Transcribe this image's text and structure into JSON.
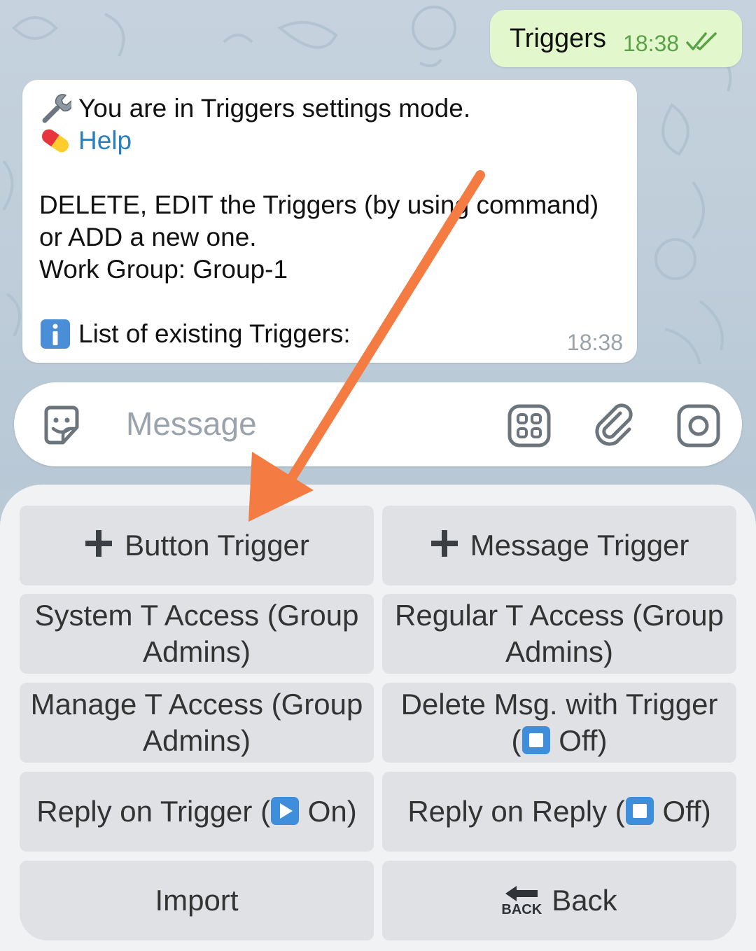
{
  "chat": {
    "outgoing": {
      "text": "Triggers",
      "time": "18:38"
    },
    "incoming": {
      "line1": "You are in Triggers settings mode.",
      "help": "Help",
      "line3": "DELETE, EDIT the Triggers (by using command)",
      "line4": "or ADD a new one.",
      "line5": "Work Group: Group-1",
      "line7": "List of existing Triggers:",
      "time": "18:38"
    }
  },
  "input": {
    "placeholder": "Message"
  },
  "keyboard": {
    "button_trigger": "Button Trigger",
    "message_trigger": "Message Trigger",
    "system_access": "System T Access (Group Admins)",
    "regular_access": "Regular T Access (Group Admins)",
    "manage_access": "Manage T Access (Group Admins)",
    "delete_msg_a": "Delete Msg. with Trigger",
    "delete_msg_b_pre": "(",
    "delete_msg_b_post": " Off)",
    "reply_trigger_pre": "Reply on Trigger (",
    "reply_trigger_post": " On)",
    "reply_reply_pre": "Reply on Reply (",
    "reply_reply_post": " Off)",
    "import": "Import",
    "back": "Back",
    "back_icon_text": "BACK"
  },
  "icons": {
    "wrench": "wrench-icon",
    "pill": "pill-icon",
    "info": "info-icon",
    "sticker": "sticker-icon",
    "apps": "apps-icon",
    "attach": "paperclip-icon",
    "camera": "camera-icon",
    "plus": "plus-icon",
    "stop": "stop-button-icon",
    "play": "play-button-icon",
    "back_arrow": "back-arrow-icon"
  },
  "colors": {
    "outgoing_bubble": "#e2f7cb",
    "check_color": "#5aa248",
    "link": "#2a7fc1",
    "arrow": "#f47c42",
    "button_bg": "#dfe1e4",
    "panel_bg": "#f1f2f4"
  }
}
